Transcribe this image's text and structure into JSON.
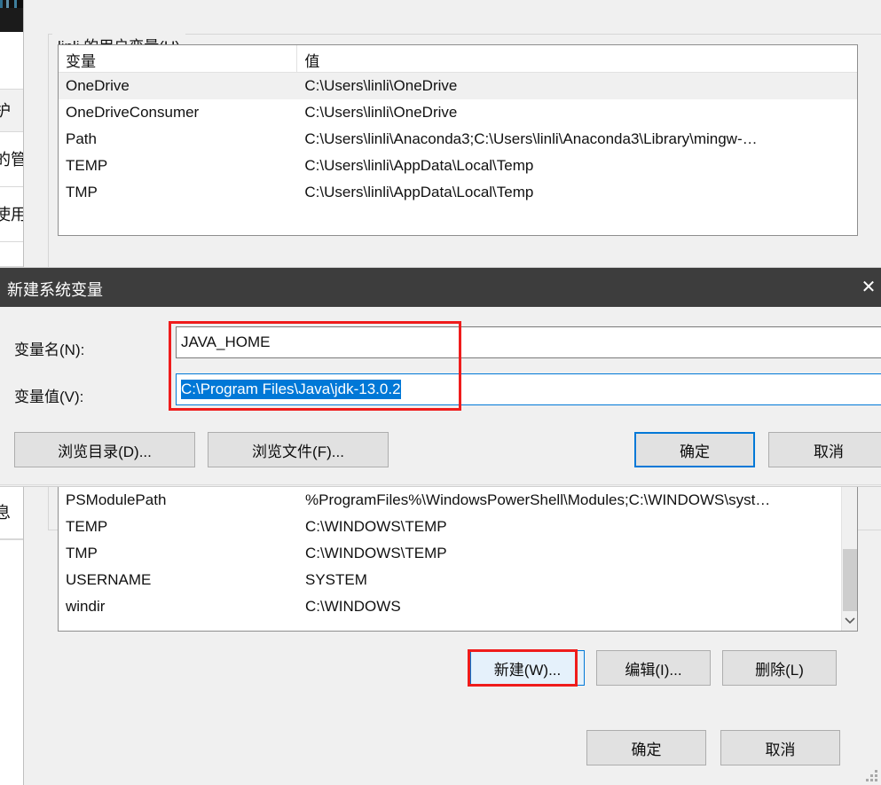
{
  "background_window": {
    "rows": [
      {
        "text": "护"
      },
      {
        "text": "的管"
      },
      {
        "text": "使用"
      },
      {
        "text": "息"
      }
    ]
  },
  "env_dialog": {
    "user_group": {
      "legend": "linli 的用户变量(U)",
      "columns": [
        "变量",
        "值"
      ],
      "rows": [
        {
          "name": "OneDrive",
          "value": "C:\\Users\\linli\\OneDrive",
          "selected": true
        },
        {
          "name": "OneDriveConsumer",
          "value": "C:\\Users\\linli\\OneDrive",
          "selected": false
        },
        {
          "name": "Path",
          "value": "C:\\Users\\linli\\Anaconda3;C:\\Users\\linli\\Anaconda3\\Library\\mingw-…",
          "selected": false
        },
        {
          "name": "TEMP",
          "value": "C:\\Users\\linli\\AppData\\Local\\Temp",
          "selected": false
        },
        {
          "name": "TMP",
          "value": "C:\\Users\\linli\\AppData\\Local\\Temp",
          "selected": false
        }
      ]
    },
    "system_group": {
      "rows": [
        {
          "name": "PSModulePath",
          "value": "%ProgramFiles%\\WindowsPowerShell\\Modules;C:\\WINDOWS\\syst…"
        },
        {
          "name": "TEMP",
          "value": "C:\\WINDOWS\\TEMP"
        },
        {
          "name": "TMP",
          "value": "C:\\WINDOWS\\TEMP"
        },
        {
          "name": "USERNAME",
          "value": "SYSTEM"
        },
        {
          "name": "windir",
          "value": "C:\\WINDOWS"
        }
      ],
      "buttons": {
        "new": "新建(W)...",
        "edit": "编辑(I)...",
        "delete": "删除(L)"
      }
    },
    "footer": {
      "ok": "确定",
      "cancel": "取消"
    }
  },
  "new_variable_dialog": {
    "title": "新建系统变量",
    "close_icon": "✕",
    "name_label": "变量名(N):",
    "name_value": "JAVA_HOME",
    "value_label": "变量值(V):",
    "value_value": "C:\\Program Files\\Java\\jdk-13.0.2",
    "browse_directory": "浏览目录(D)...",
    "browse_file": "浏览文件(F)...",
    "ok": "确定",
    "cancel": "取消"
  },
  "colors": {
    "accent": "#0078d7",
    "annotation": "#ef1c1c",
    "selection": "#0078d7",
    "titlebar": "#3d3d3d",
    "dialog_background": "#f0f0f0"
  }
}
